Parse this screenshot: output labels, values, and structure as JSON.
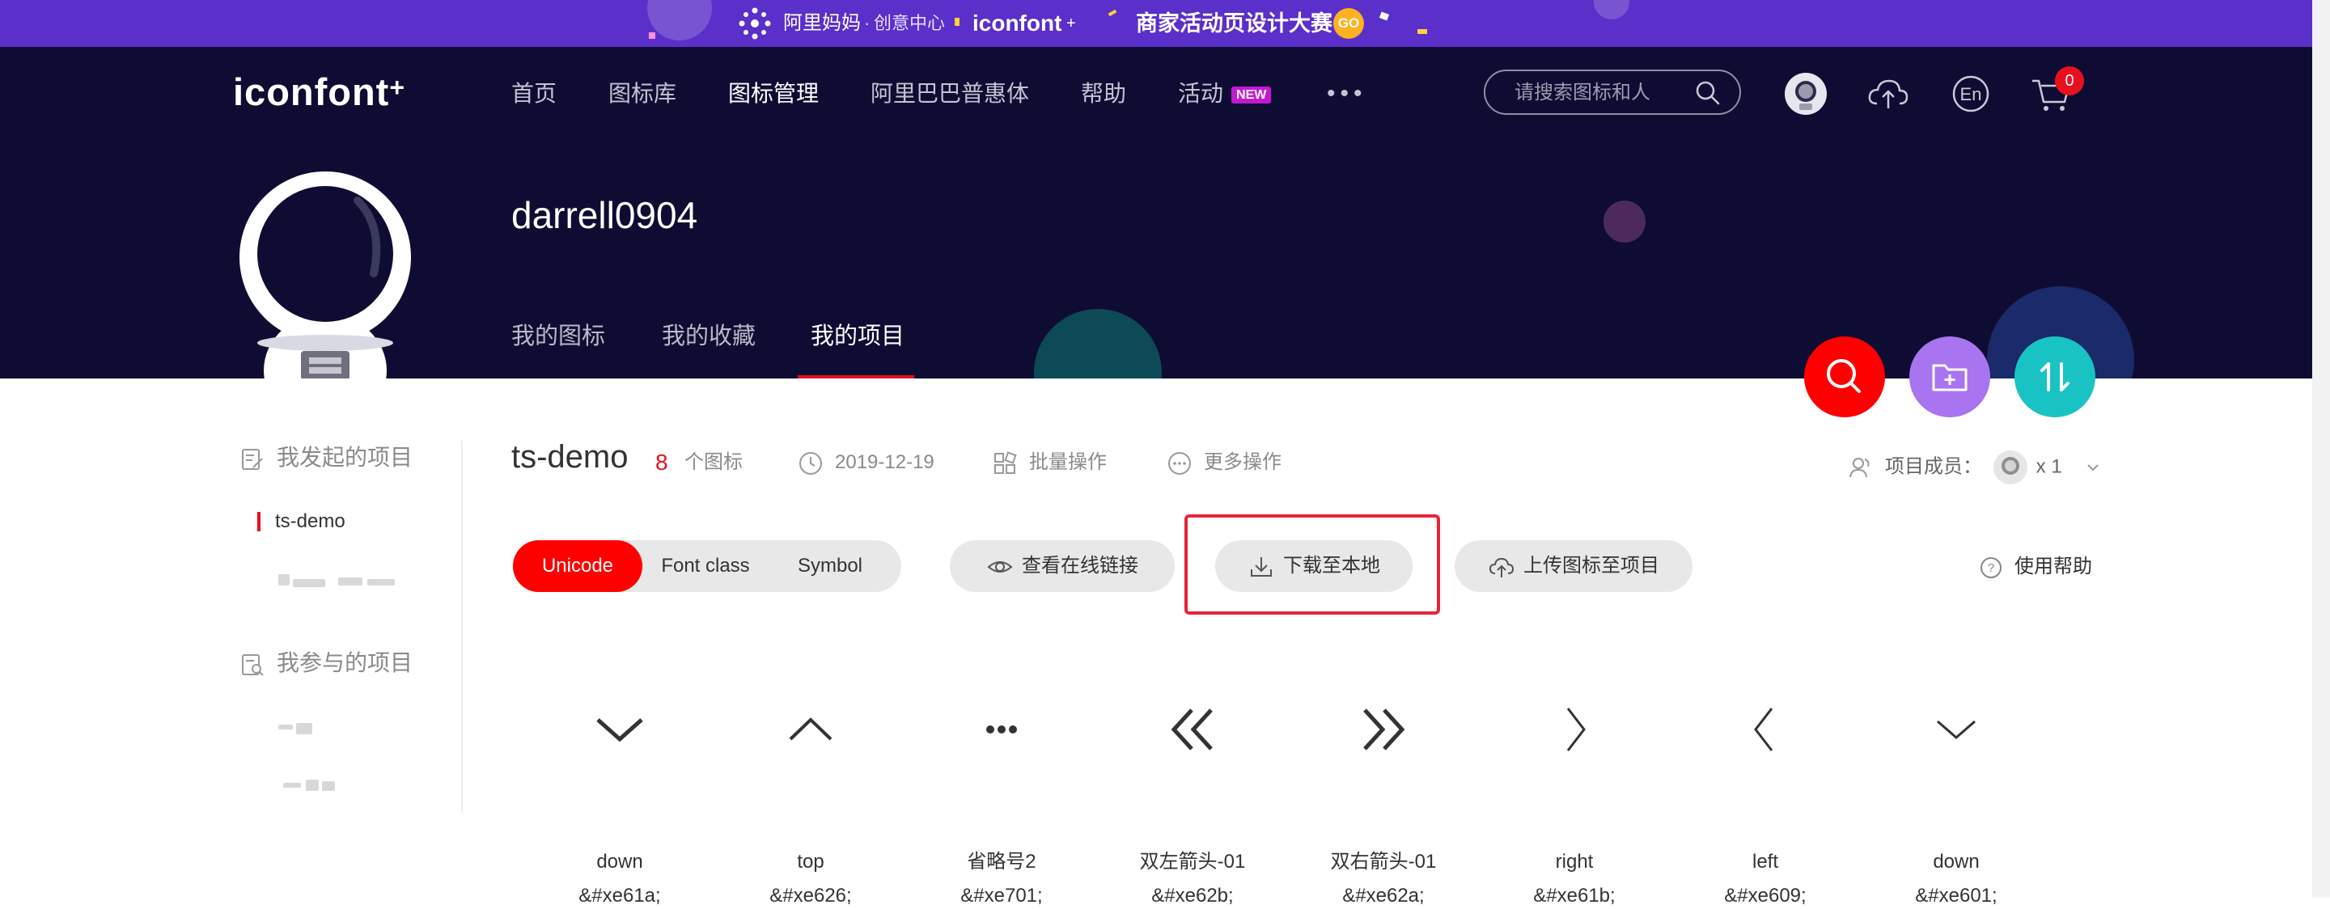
{
  "promo_banner": {
    "brand": "阿里妈妈",
    "center": "创意中心",
    "logo": "iconfont",
    "campaign": "商家活动页设计大赛",
    "go_label": "GO"
  },
  "header": {
    "logo_text": "iconfont",
    "nav": [
      {
        "label": "首页"
      },
      {
        "label": "图标库"
      },
      {
        "label": "图标管理"
      },
      {
        "label": "阿里巴巴普惠体"
      },
      {
        "label": "帮助"
      },
      {
        "label": "活动",
        "badge": "NEW"
      }
    ],
    "more_label": "•••",
    "search_placeholder": "请搜索图标和人",
    "lang_label": "En",
    "cart_count": "0"
  },
  "profile": {
    "username": "darrell0904",
    "tabs": [
      {
        "label": "我的图标"
      },
      {
        "label": "我的收藏"
      },
      {
        "label": "我的项目"
      }
    ]
  },
  "sidebar": {
    "my_projects_heading": "我发起的项目",
    "my_projects": [
      "ts-demo"
    ],
    "joined_projects_heading": "我参与的项目"
  },
  "project": {
    "name": "ts-demo",
    "icon_count": "8",
    "icon_count_unit": "个图标",
    "date": "2019-12-19",
    "batch_label": "批量操作",
    "more_label": "更多操作",
    "members_label": "项目成员：",
    "members_count": "x 1",
    "segments": [
      "Unicode",
      "Font class",
      "Symbol"
    ],
    "view_link_label": "查看在线链接",
    "download_label": "下载至本地",
    "upload_label": "上传图标至项目",
    "help_label": "使用帮助"
  },
  "icons": [
    {
      "name": "down",
      "code": "&#xe61a;",
      "glyph": "chevron-down-icon"
    },
    {
      "name": "top",
      "code": "&#xe626;",
      "glyph": "chevron-up-icon"
    },
    {
      "name": "省略号2",
      "code": "&#xe701;",
      "glyph": "ellipsis-icon"
    },
    {
      "name": "双左箭头-01",
      "code": "&#xe62b;",
      "glyph": "double-left-icon"
    },
    {
      "name": "双右箭头-01",
      "code": "&#xe62a;",
      "glyph": "double-right-icon"
    },
    {
      "name": "right",
      "code": "&#xe61b;",
      "glyph": "chevron-right-icon"
    },
    {
      "name": "left",
      "code": "&#xe609;",
      "glyph": "chevron-left-icon"
    },
    {
      "name": "down",
      "code": "&#xe601;",
      "glyph": "chevron-down-icon"
    }
  ],
  "colors": {
    "accent_red": "#ff0000",
    "header_bg": "#0f0c33",
    "promo_bg": "#5b2fc9",
    "fab_search": "#ff0000",
    "fab_folder": "#a874f0",
    "fab_sort": "#19c3c3"
  }
}
